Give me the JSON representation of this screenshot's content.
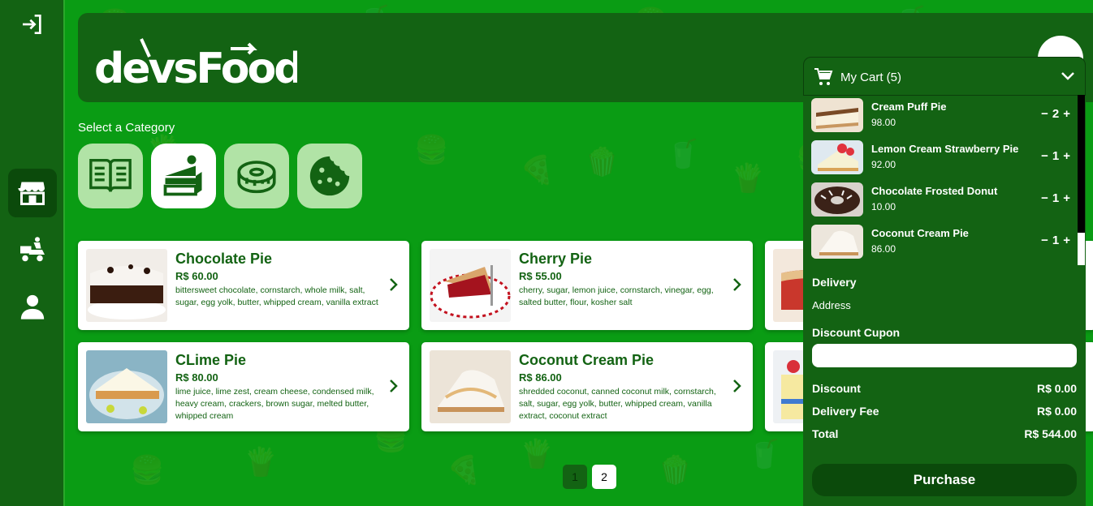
{
  "brand": {
    "logo_text": "devsFood"
  },
  "sidebar": {
    "items": [
      {
        "icon": "logout-icon"
      },
      {
        "icon": "store-icon",
        "active": true
      },
      {
        "icon": "delivery-icon"
      },
      {
        "icon": "user-icon"
      }
    ]
  },
  "categories": {
    "title": "Select a Category",
    "items": [
      {
        "icon": "menu-book-icon",
        "active": false
      },
      {
        "icon": "cake-icon",
        "active": true
      },
      {
        "icon": "donut-icon",
        "active": false
      },
      {
        "icon": "cookie-icon",
        "active": false
      }
    ]
  },
  "products": [
    {
      "name": "Chocolate Pie",
      "price": "R$ 60.00",
      "ingredients": "bittersweet chocolate, cornstarch, whole milk, salt, sugar, egg yolk, butter, whipped cream, vanilla extract"
    },
    {
      "name": "Cherry Pie",
      "price": "R$ 55.00",
      "ingredients": "cherry, sugar, lemon juice, cornstarch, vinegar, egg, salted butter, flour, kosher salt"
    },
    {
      "name": "CLime Pie",
      "price": "R$ 80.00",
      "ingredients": "lime juice, lime zest, cream cheese, condensed milk, heavy cream, crackers, brown sugar, melted butter, whipped cream"
    },
    {
      "name": "Coconut Cream Pie",
      "price": "R$ 86.00",
      "ingredients": "shredded coconut, canned coconut milk, cornstarch, salt, sugar, egg yolk, butter, whipped cream, vanilla extract, coconut extract"
    }
  ],
  "pagination": {
    "pages": [
      "1",
      "2"
    ],
    "current": "1"
  },
  "cart": {
    "title": "My Cart (5)",
    "items": [
      {
        "name": "Cream Puff Pie",
        "price": "98.00",
        "qty": "2"
      },
      {
        "name": "Lemon Cream Strawberry Pie",
        "price": "92.00",
        "qty": "1"
      },
      {
        "name": "Chocolate Frosted Donut",
        "price": "10.00",
        "qty": "1"
      },
      {
        "name": "Coconut Cream Pie",
        "price": "86.00",
        "qty": "1"
      }
    ],
    "minus": "−",
    "plus": "+",
    "delivery_label": "Delivery",
    "address_label": "Address",
    "coupon_label": "Discount Cupon",
    "coupon_value": "",
    "discount_label": "Discount",
    "discount_value": "R$ 0.00",
    "fee_label": "Delivery Fee",
    "fee_value": "R$ 0.00",
    "total_label": "Total",
    "total_value": "R$ 544.00",
    "purchase_label": "Purchase"
  },
  "colors": {
    "background": "#0a9c14",
    "dark_green": "#136313",
    "category_tile": "#b1e3a6"
  }
}
